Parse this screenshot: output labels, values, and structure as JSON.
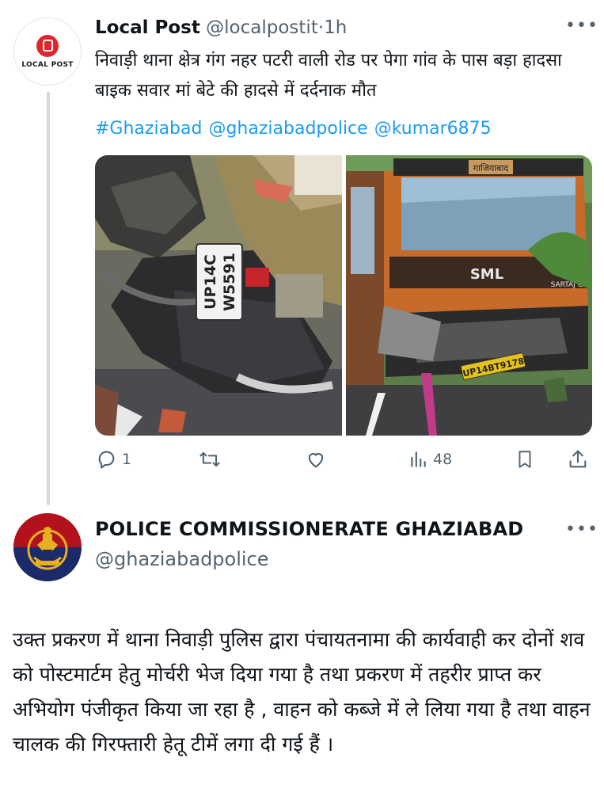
{
  "tweet1": {
    "display_name": "Local Post",
    "handle": "@localpostit",
    "separator": "·",
    "time": "1h",
    "avatar_text": "LOCAL POST",
    "text": "निवाड़ी थाना क्षेत्र गंग नहर पटरी वाली रोड पर पेगा गांव के पास बड़ा हादसा बाइक सवार मां बेटे की हादसे में दर्दनाक मौत",
    "links": [
      "#Ghaziabad",
      "@ghaziabadpolice",
      "@kumar6875"
    ],
    "media": {
      "left_plate": [
        "UP14C",
        "W5591"
      ],
      "right_plate": "UP14BT9178",
      "truck_brand": "SML",
      "truck_model": "SARTAJ GS",
      "truck_sign": "गाजियाबाद"
    },
    "actions": {
      "reply_count": "1",
      "retweet_count": "",
      "like_count": "",
      "views_count": "48"
    },
    "more_icon": "ellipsis-icon"
  },
  "tweet2": {
    "display_name": "POLICE COMMISSIONERATE GHAZIABAD",
    "handle": "@ghaziabadpolice",
    "text": "उक्त प्रकरण में थाना निवाड़ी पुलिस द्वारा पंचायतनामा की कार्यवाही कर दोनों शव को पोस्टमार्टम हेतु मोर्चरी भेज दिया गया है तथा प्रकरण में तहरीर प्राप्त कर अभियोग पंजीकृत किया जा रहा है , वाहन को कब्जे में ले लिया गया है तथा वाहन चालक की गिरफ्तारी हेतू टीमें लगा दी गई हैं ।",
    "more_icon": "ellipsis-icon"
  },
  "colors": {
    "link": "#1d9bf0",
    "muted": "#536471",
    "text": "#0f1419",
    "thread_line": "#cfd9de",
    "local_post_red": "#e0262b",
    "police_red": "#b3121d"
  }
}
